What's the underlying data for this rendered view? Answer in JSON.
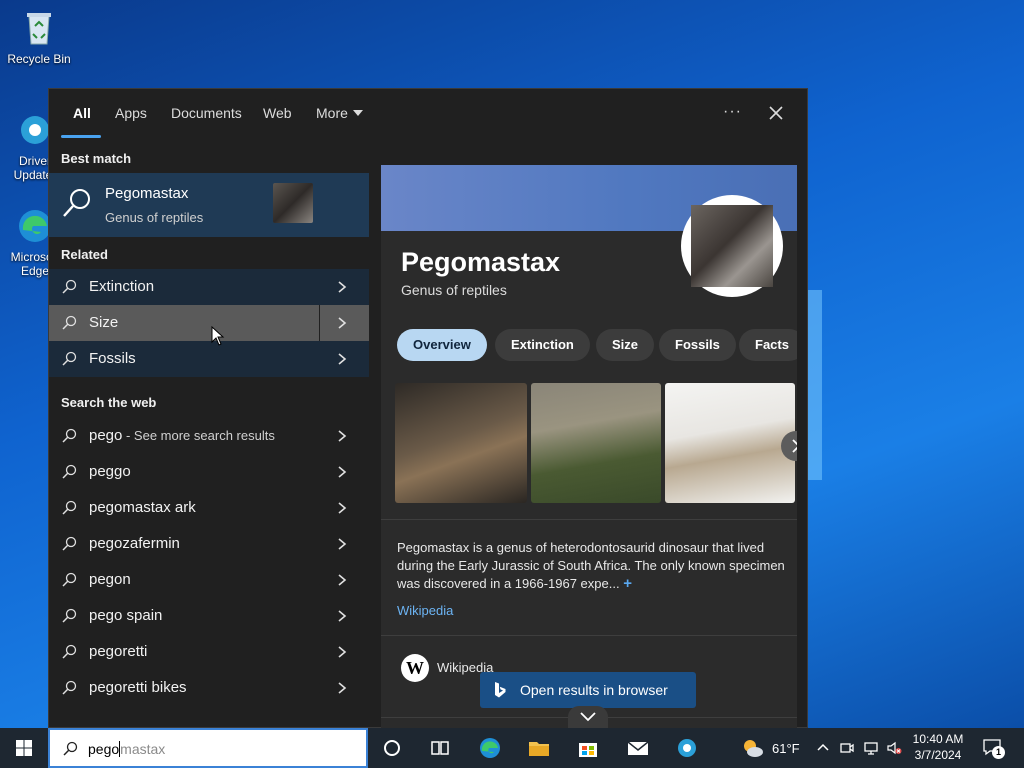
{
  "desktop": {
    "icons": [
      {
        "label": "Recycle Bin"
      },
      {
        "label": "Driver Updater"
      },
      {
        "label": "Microsoft Edge"
      }
    ]
  },
  "search_panel": {
    "tabs": [
      {
        "label": "All",
        "active": true
      },
      {
        "label": "Apps"
      },
      {
        "label": "Documents"
      },
      {
        "label": "Web"
      },
      {
        "label": "More"
      }
    ],
    "options_label": "···",
    "best_match_label": "Best match",
    "best_match": {
      "title": "Pegomastax",
      "subtitle": "Genus of reptiles"
    },
    "related_label": "Related",
    "related": [
      {
        "label": "Extinction"
      },
      {
        "label": "Size"
      },
      {
        "label": "Fossils"
      }
    ],
    "web_label": "Search the web",
    "web_results": [
      {
        "label": "pego",
        "extra": " - See more search results"
      },
      {
        "label": "peggo",
        "extra": ""
      },
      {
        "label": "pegomastax ark",
        "extra": ""
      },
      {
        "label": "pegozafermin",
        "extra": ""
      },
      {
        "label": "pegon",
        "extra": ""
      },
      {
        "label": "pego spain",
        "extra": ""
      },
      {
        "label": "pegoretti",
        "extra": ""
      },
      {
        "label": "pegoretti bikes",
        "extra": ""
      }
    ],
    "preview": {
      "title": "Pegomastax",
      "subtitle": "Genus of reptiles",
      "pills": [
        {
          "label": "Overview",
          "active": true
        },
        {
          "label": "Extinction"
        },
        {
          "label": "Size"
        },
        {
          "label": "Fossils"
        },
        {
          "label": "Facts"
        }
      ],
      "description": "Pegomastax is a genus of heterodontosaurid dinosaur that lived during the Early Jurassic of South Africa. The only known specimen was discovered in a 1966-1967 expe...",
      "expand_label": "+",
      "source_link": "Wikipedia",
      "source_name": "Wikipedia",
      "source_logo_letter": "W"
    },
    "open_browser_label": "Open results in browser"
  },
  "taskbar": {
    "search_typed": "pego",
    "search_suggest": "mastax",
    "weather": {
      "temp": "61°F"
    },
    "clock": {
      "time": "10:40 AM",
      "date": "3/7/2024"
    },
    "notifications": "1"
  },
  "colors": {
    "accent": "#4aa3f0",
    "panel_bg": "#202020",
    "best_match_bg": "#1f3a55",
    "taskbar_bg": "#1e2731"
  }
}
